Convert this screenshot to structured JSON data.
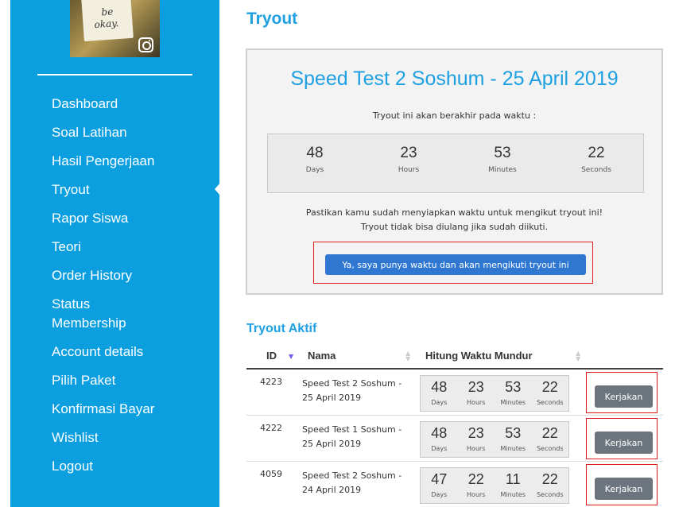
{
  "sidebar": {
    "avatar_text": [
      "be",
      "okay."
    ],
    "nav": [
      "Dashboard",
      "Soal Latihan",
      "Hasil Pengerjaan",
      "Tryout",
      "Rapor Siswa",
      "Teori",
      "Order History",
      "Status\nMembership",
      "Account details",
      "Pilih Paket",
      "Konfirmasi Bayar",
      "Wishlist",
      "Logout"
    ],
    "active": "Tryout"
  },
  "main": {
    "page_title": "Tryout",
    "panel": {
      "title": "Speed Test 2 Soshum - 25 April 2019",
      "subtitle": "Tryout ini akan berakhir pada waktu :",
      "countdown": [
        {
          "value": "48",
          "label": "Days"
        },
        {
          "value": "23",
          "label": "Hours"
        },
        {
          "value": "53",
          "label": "Minutes"
        },
        {
          "value": "22",
          "label": "Seconds"
        }
      ],
      "note_line1": "Pastikan kamu sudah menyiapkan waktu untuk mengikut tryout ini!",
      "note_line2": "Tryout tidak bisa diulang jika sudah diikuti.",
      "cta_label": "Ya, saya punya waktu dan akan mengikuti tryout ini"
    },
    "active_title": "Tryout Aktif",
    "table": {
      "headers": [
        "ID",
        "Nama",
        "Hitung Waktu Mundur"
      ],
      "units": [
        "Days",
        "Hours",
        "Minutes",
        "Seconds"
      ],
      "rows": [
        {
          "id": "4223",
          "name": "Speed Test 2 Soshum - 25 April 2019",
          "countdown": [
            "48",
            "23",
            "53",
            "22"
          ],
          "action": "Kerjakan"
        },
        {
          "id": "4222",
          "name": "Speed Test 1 Soshum - 25 April 2019",
          "countdown": [
            "48",
            "23",
            "53",
            "22"
          ],
          "action": "Kerjakan"
        },
        {
          "id": "4059",
          "name": "Speed Test 2 Soshum - 24 April 2019",
          "countdown": [
            "47",
            "22",
            "11",
            "22"
          ],
          "action": "Kerjakan"
        }
      ]
    }
  },
  "colors": {
    "sidebar_bg": "#0c9fe0",
    "accent": "#1ea0e2",
    "cta": "#2f77d0",
    "action_btn": "#6c757d",
    "highlight": "#e01b1b"
  }
}
